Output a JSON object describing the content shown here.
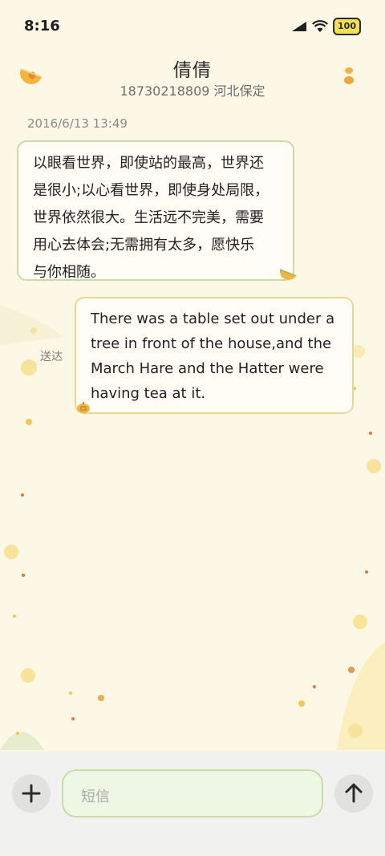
{
  "status_bar": {
    "time": "8:16",
    "battery": "100",
    "icons": [
      "signal-icon",
      "wifi-icon",
      "battery-icon"
    ]
  },
  "header": {
    "contact_name": "倩倩",
    "contact_detail": "18730218809 河北保定",
    "left_icon": "melon-icon",
    "right_icon": "more-icon"
  },
  "messages": [
    {
      "direction": "incoming",
      "timestamp": "2016/6/13 13:49",
      "lines": [
        "以眼看世界，即使站的最高，世界还",
        "是很小;以心看世界，即使身处局限，",
        "世界依然很大。生活远不完美，需要",
        "用心去体会;无需拥有太多，愿快乐",
        "与你相随。"
      ]
    },
    {
      "direction": "outgoing",
      "status": "送达",
      "lines": [
        "There was a table set out under a",
        "tree in front of the house,and the",
        "March Hare and the Hatter were",
        "having tea at it."
      ]
    }
  ],
  "composer": {
    "placeholder": "短信",
    "add_icon": "plus-icon",
    "send_icon": "arrow-up-icon"
  },
  "colors": {
    "background": "#fdf8e6",
    "incoming_border": "#c9dca7",
    "outgoing_border": "#e8d990",
    "melon": "#f3b43c"
  }
}
